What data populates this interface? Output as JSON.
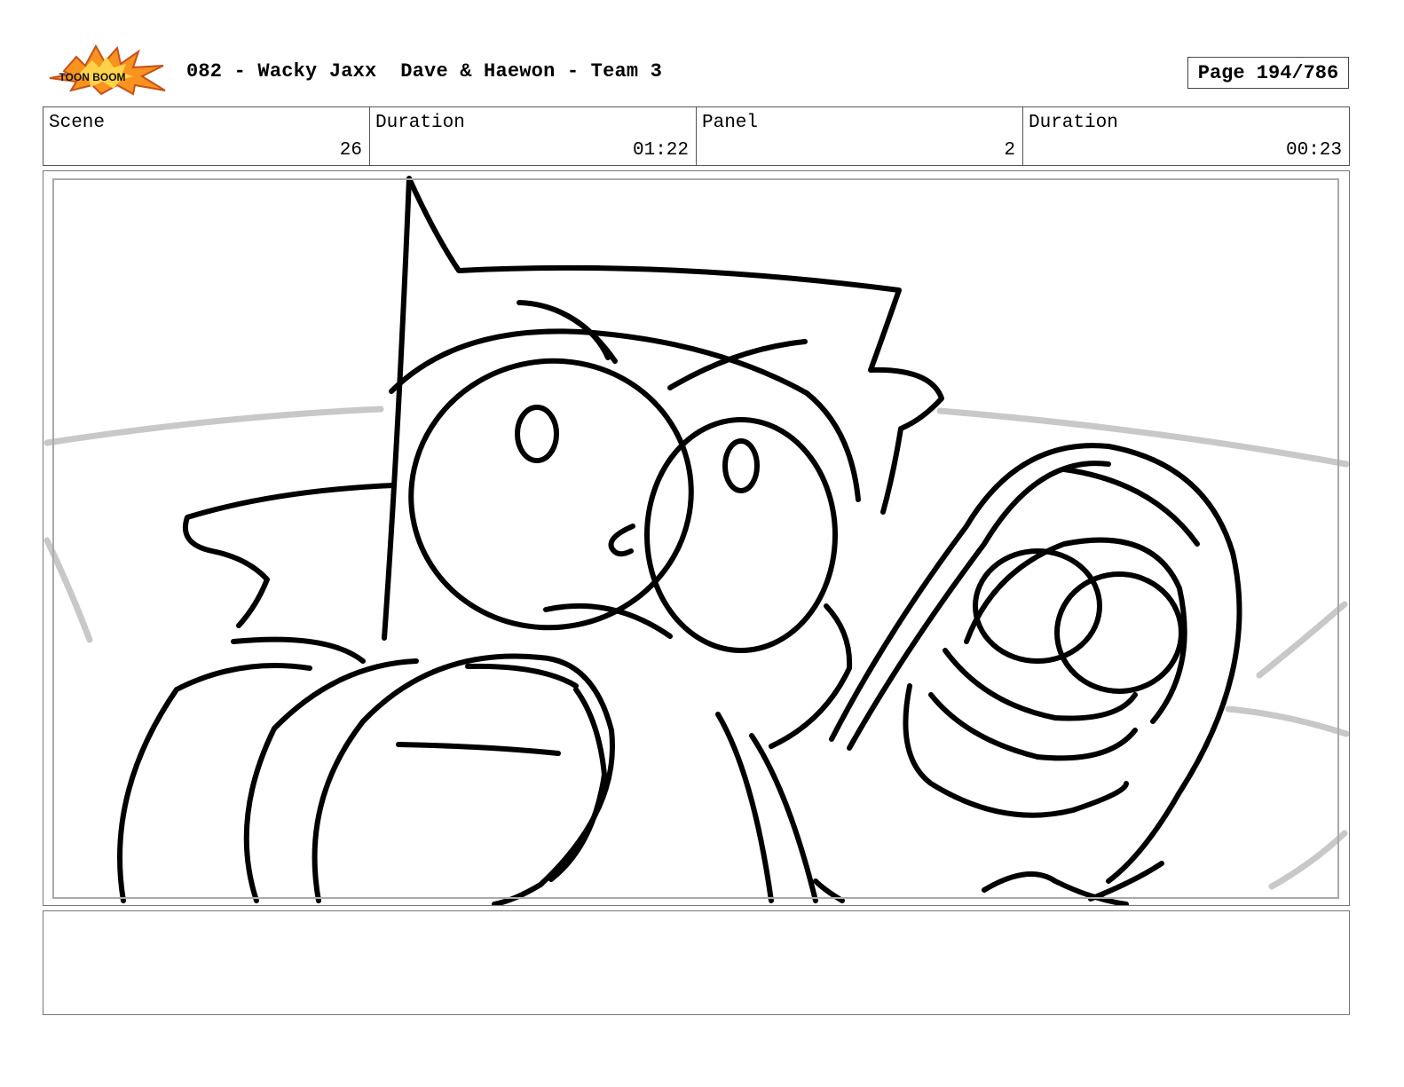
{
  "header": {
    "logo_text": "TOON BOOM",
    "title": "082 - Wacky Jaxx  Dave & Haewon - Team 3",
    "page_label": "Page 194/786"
  },
  "info": {
    "scene_label": "Scene",
    "scene_value": "26",
    "scene_duration_label": "Duration",
    "scene_duration_value": "01:22",
    "panel_label": "Panel",
    "panel_value": "2",
    "panel_duration_label": "Duration",
    "panel_duration_value": "00:23"
  },
  "panel": {
    "image": "pencil-sketch-character-punching"
  },
  "notes": {
    "text": ""
  }
}
